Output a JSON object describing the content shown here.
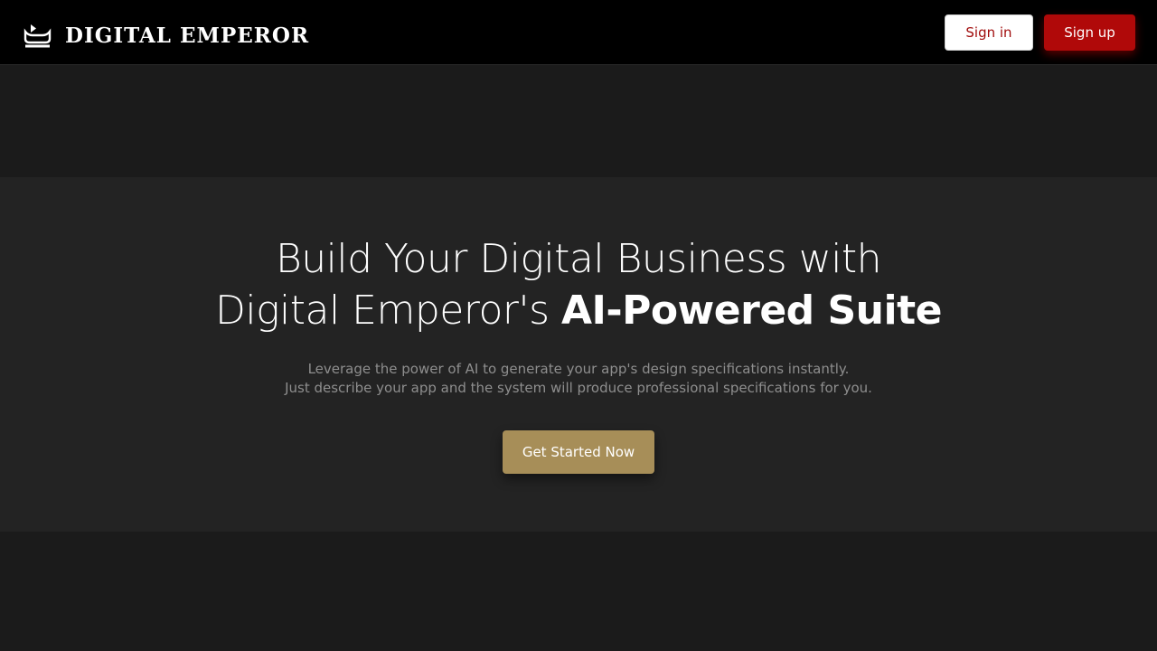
{
  "header": {
    "brand_name": "DIGITAL EMPEROR",
    "logo_icon": "crown-icon",
    "signin_label": "Sign in",
    "signup_label": "Sign up"
  },
  "hero": {
    "headline_line1": "Build Your Digital Business with",
    "headline_line2_regular": "Digital Emperor's ",
    "headline_line2_bold": "AI-Powered Suite",
    "subtext_line1": "Leverage the power of AI to generate your app's design specifications instantly.",
    "subtext_line2": "Just describe your app and the system will produce professional specifications for you.",
    "cta_label": "Get Started Now"
  },
  "colors": {
    "header_bg": "#000000",
    "page_bg": "#1b1b1b",
    "hero_bg": "#232323",
    "signup_red": "#b00909",
    "signin_text_red": "#a10c0c",
    "cta_gold": "#a78e58"
  }
}
